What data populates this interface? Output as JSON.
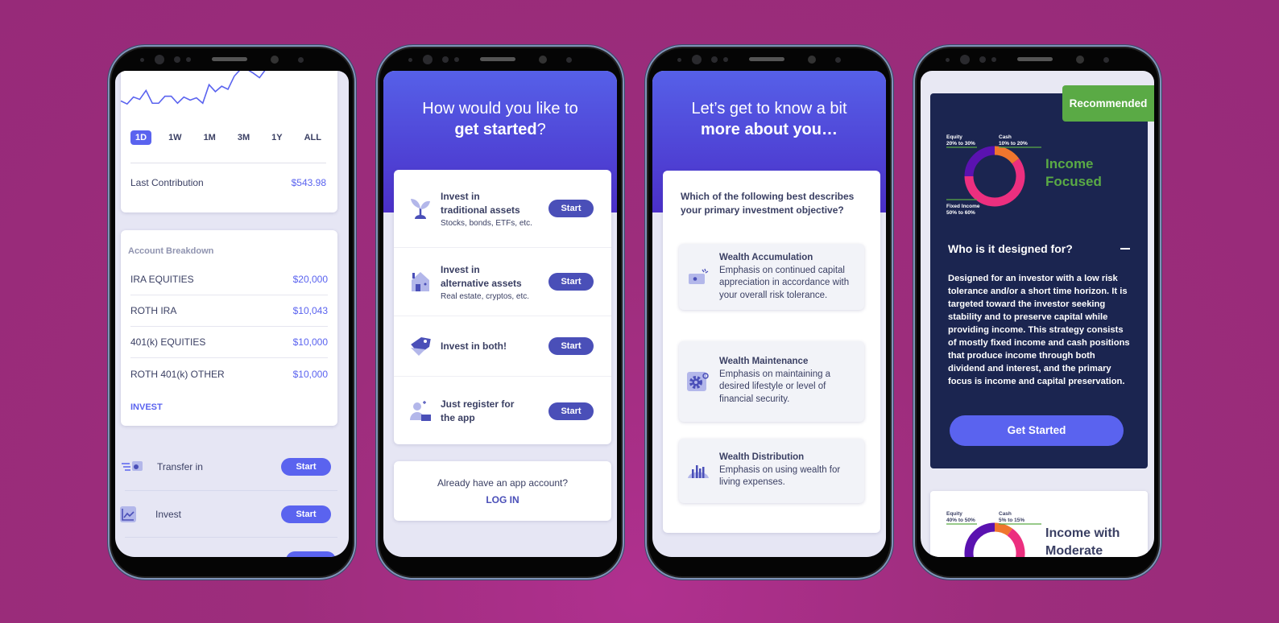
{
  "colors": {
    "background": "#9d2d7c",
    "accent": "#5a63ef",
    "button": "#4a4fb8",
    "navy_card": "#1b2550",
    "green": "#5aaa45",
    "text": "#3a3f63"
  },
  "phone1": {
    "sparkline": [
      0.18,
      0.1,
      0.28,
      0.22,
      0.45,
      0.12,
      0.12,
      0.3,
      0.3,
      0.12,
      0.28,
      0.2,
      0.26,
      0.12,
      0.6,
      0.42,
      0.56,
      0.48,
      0.82,
      1.0,
      1.0,
      0.9,
      0.78,
      1.0
    ],
    "ranges": [
      "1D",
      "1W",
      "1M",
      "3M",
      "1Y",
      "ALL"
    ],
    "active_range": "1D",
    "last_contribution_label": "Last Contribution",
    "last_contribution_value": "$543.98",
    "breakdown_title": "Account Breakdown",
    "accounts": [
      {
        "name": "IRA EQUITIES",
        "value": "$20,000"
      },
      {
        "name": "ROTH IRA",
        "value": "$10,043"
      },
      {
        "name": "401(k) EQUITIES",
        "value": "$10,000"
      },
      {
        "name": "ROTH 401(k) OTHER",
        "value": "$10,000"
      }
    ],
    "invest_link": "INVEST",
    "actions": [
      {
        "icon": "transfer-icon",
        "label": "Transfer in",
        "button": "Start"
      },
      {
        "icon": "chart-icon",
        "label": "Invest",
        "button": "Start"
      }
    ]
  },
  "phone2": {
    "title_line1": "How would you like to",
    "title_bold": "get started",
    "title_suffix": "?",
    "options": [
      {
        "icon": "plant-icon",
        "title1": "Invest in",
        "title2": "traditional assets",
        "sub": "Stocks, bonds, ETFs, etc.",
        "button": "Start"
      },
      {
        "icon": "house-icon",
        "title1": "Invest in",
        "title2": "alternative assets",
        "sub": "Real estate, cryptos, etc.",
        "button": "Start"
      },
      {
        "icon": "tag-icon",
        "title1": "Invest in both!",
        "title2": "",
        "sub": "",
        "button": "Start"
      },
      {
        "icon": "user-register-icon",
        "title1": "Just register for",
        "title2": "the app",
        "sub": "",
        "button": "Start"
      }
    ],
    "login_prompt": "Already have an app account?",
    "login_link": "LOG IN"
  },
  "phone3": {
    "title_line1": "Let’s get to know a bit",
    "title_bold": "more about you…",
    "question": "Which of the following best describes your primary investment objective?",
    "objectives": [
      {
        "icon": "wallet-sparkle-icon",
        "title": "Wealth Accumulation",
        "desc": "Emphasis on continued capital appreciation in accordance with your overall risk tolerance."
      },
      {
        "icon": "gear-icon",
        "title": "Wealth Maintenance",
        "desc": "Emphasis on maintaining a desired lifestyle or level of financial security."
      },
      {
        "icon": "bar-distribution-icon",
        "title": "Wealth Distribution",
        "desc": "Emphasis on using wealth for living expenses."
      }
    ]
  },
  "phone4": {
    "badge": "Recommended",
    "portfolio1": {
      "name_line1": "Income",
      "name_line2": "Focused",
      "allocations": [
        {
          "label": "Equity",
          "range": "20% to 30%"
        },
        {
          "label": "Cash",
          "range": "10% to 20%"
        },
        {
          "label": "Fixed Income",
          "range": "50% to 60%"
        }
      ],
      "donut": [
        {
          "name": "Cash",
          "value": 15,
          "color": "#f0762e"
        },
        {
          "name": "Fixed Income",
          "value": 60,
          "color": "#ec2f7f"
        },
        {
          "name": "Equity",
          "value": 25,
          "color": "#5a12b0"
        }
      ],
      "question": "Who is it designed for?",
      "collapse_icon": "minus-icon",
      "description": "Designed for an investor with a low risk tolerance and/or a short time horizon. It is targeted toward the investor seeking stability and to preserve capital while providing income. This strategy consists of mostly fixed income and cash positions that produce income through both dividend and interest, and the primary focus is income and capital preservation.",
      "cta": "Get Started"
    },
    "portfolio2": {
      "name_line1": "Income with",
      "name_line2": "Moderate",
      "allocations": [
        {
          "label": "Equity",
          "range": "40% to 50%"
        },
        {
          "label": "Cash",
          "range": "5% to 15%"
        }
      ],
      "donut": [
        {
          "name": "Cash",
          "value": 10,
          "color": "#f0762e"
        },
        {
          "name": "Fixed Income",
          "value": 45,
          "color": "#ec2f7f"
        },
        {
          "name": "Equity",
          "value": 45,
          "color": "#5a12b0"
        }
      ]
    }
  }
}
